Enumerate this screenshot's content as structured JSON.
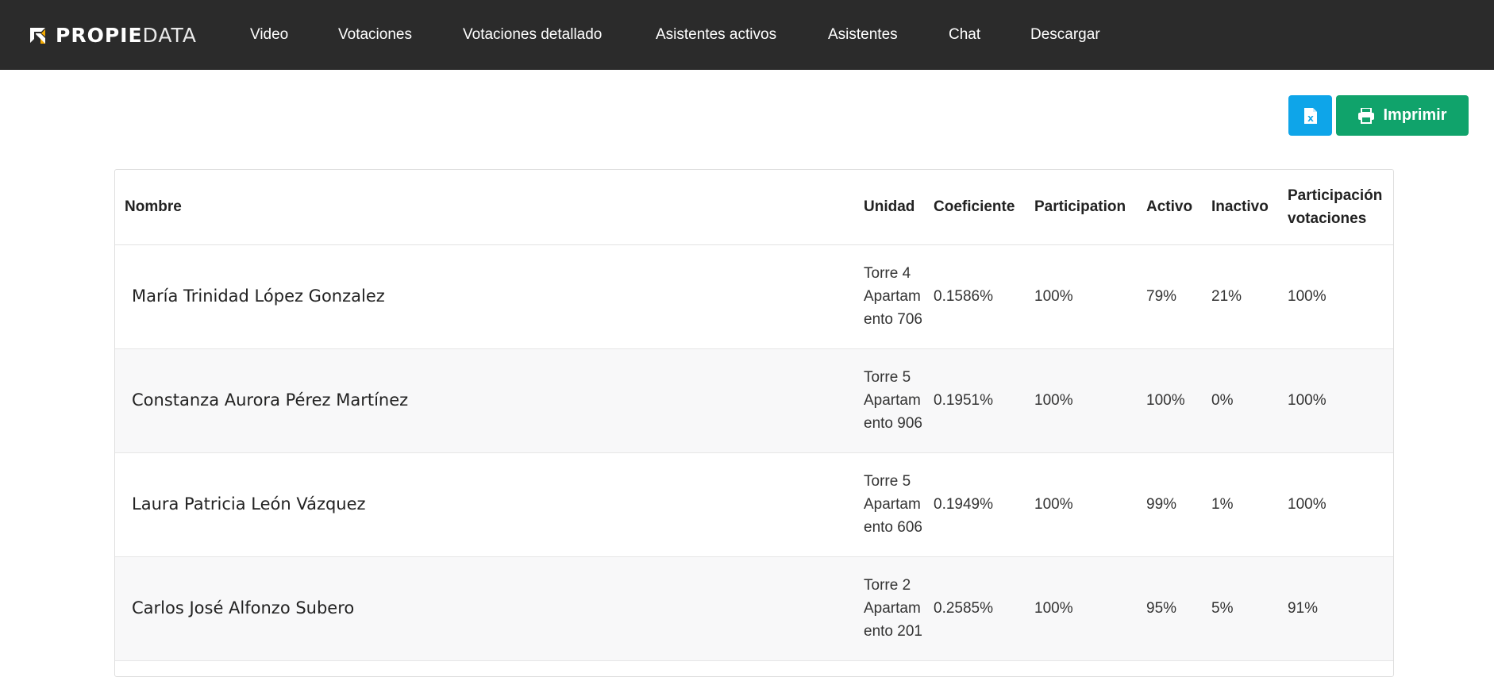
{
  "brand": {
    "name_bold": "PROPIE",
    "name_light": "DATA",
    "accent_color": "#f2a900"
  },
  "nav": {
    "items": [
      {
        "label": "Video"
      },
      {
        "label": "Votaciones"
      },
      {
        "label": "Votaciones detallado"
      },
      {
        "label": "Asistentes activos"
      },
      {
        "label": "Asistentes"
      },
      {
        "label": "Chat"
      },
      {
        "label": "Descargar"
      }
    ]
  },
  "toolbar": {
    "excel_icon": "excel-icon",
    "excel_color": "#0ea5e9",
    "print_label": "Imprimir",
    "print_icon": "printer-icon",
    "print_color": "#10a36b"
  },
  "table": {
    "headers": {
      "nombre": "Nombre",
      "unidad": "Unidad",
      "coeficiente": "Coeficiente",
      "participation": "Participation",
      "activo": "Activo",
      "inactivo": "Inactivo",
      "participacion_votaciones": "Participación votaciones"
    },
    "rows": [
      {
        "nombre": "María Trinidad López Gonzalez",
        "unidad": "Torre 4 Apartamento 706",
        "coeficiente": "0.1586%",
        "participation": "100%",
        "activo": "79%",
        "inactivo": "21%",
        "participacion_votaciones": "100%"
      },
      {
        "nombre": "Constanza Aurora Pérez Martínez",
        "unidad": "Torre 5 Apartamento 906",
        "coeficiente": "0.1951%",
        "participation": "100%",
        "activo": "100%",
        "inactivo": "0%",
        "participacion_votaciones": "100%"
      },
      {
        "nombre": "Laura Patricia León Vázquez",
        "unidad": "Torre 5 Apartamento 606",
        "coeficiente": "0.1949%",
        "participation": "100%",
        "activo": "99%",
        "inactivo": "1%",
        "participacion_votaciones": "100%"
      },
      {
        "nombre": "Carlos José Alfonzo Subero",
        "unidad": "Torre 2 Apartamento 201",
        "coeficiente": "0.2585%",
        "participation": "100%",
        "activo": "95%",
        "inactivo": "5%",
        "participacion_votaciones": "91%"
      }
    ]
  }
}
